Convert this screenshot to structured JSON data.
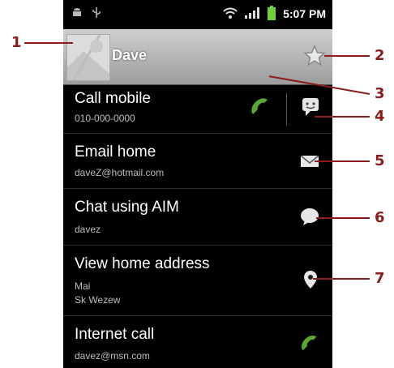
{
  "status_bar": {
    "time": "5:07 PM"
  },
  "contact": {
    "name": "Dave"
  },
  "rows": [
    {
      "title": "Call mobile",
      "sub1": "010-000-0000",
      "sub2": ""
    },
    {
      "title": "Email home",
      "sub1": "daveZ@hotmail.com",
      "sub2": ""
    },
    {
      "title": "Chat using AIM",
      "sub1": "davez",
      "sub2": ""
    },
    {
      "title": "View home address",
      "sub1": "Mai",
      "sub2": "Sk Wezew"
    },
    {
      "title": "Internet call",
      "sub1": "davez@msn.com",
      "sub2": ""
    }
  ],
  "callouts": [
    "1",
    "2",
    "3",
    "4",
    "5",
    "6",
    "7"
  ],
  "colors": {
    "callout": "#8b1c1c",
    "phone_green": "#5aa832",
    "battery_green": "#6fcf3a"
  },
  "icons": [
    "android-icon",
    "usb-icon",
    "wifi-icon",
    "signal-icon",
    "battery-icon",
    "contact-photo",
    "star-icon",
    "phone-icon",
    "sms-icon",
    "email-icon",
    "chat-icon",
    "location-pin-icon"
  ]
}
